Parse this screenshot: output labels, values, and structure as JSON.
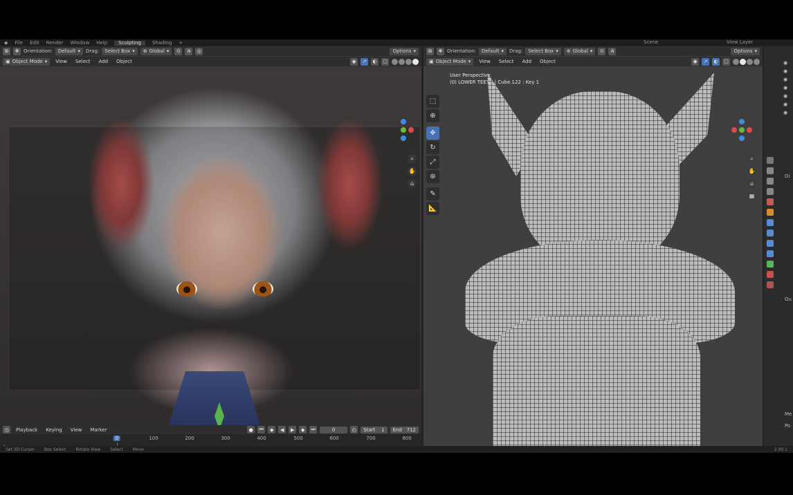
{
  "topbar": {
    "menu": [
      "File",
      "Edit",
      "Render",
      "Window",
      "Help"
    ],
    "workspace_tabs": [
      "Sculpting",
      "Shading"
    ],
    "scene_label": "Scene",
    "view_layer_label": "View Layer"
  },
  "left_editor": {
    "header": {
      "orientation_label": "Orientation:",
      "orientation_value": "Default",
      "drag_label": "Drag:",
      "drag_value": "Select Box",
      "transform_value": "Global",
      "options_label": "Options"
    },
    "subheader": {
      "mode": "Object Mode",
      "menus": [
        "View",
        "Select",
        "Add",
        "Object"
      ]
    }
  },
  "right_editor": {
    "header": {
      "orientation_label": "Orientation:",
      "orientation_value": "Default",
      "drag_label": "Drag:",
      "drag_value": "Select Box",
      "transform_value": "Global",
      "options_label": "Options"
    },
    "subheader": {
      "mode": "Object Mode",
      "menus": [
        "View",
        "Select",
        "Add",
        "Object"
      ]
    },
    "overlay": {
      "view_name": "User Perspective",
      "object_info": "(0) LOWER TEETH | Cube.122 : Key 1"
    }
  },
  "timeline": {
    "menus": [
      "Playback",
      "Keying",
      "View",
      "Marker"
    ],
    "current_frame": "0",
    "start_label": "Start",
    "start_value": "1",
    "end_label": "End",
    "end_value": "712",
    "ticks": [
      "0",
      "100",
      "200",
      "300",
      "400",
      "500",
      "600",
      "700",
      "800"
    ]
  },
  "statusbar": {
    "items": [
      "Set 3D Cursor",
      "Box Select",
      "Rotate View",
      "Select",
      "Move"
    ],
    "version": "2.90.1"
  },
  "properties": {
    "labels": [
      "Di",
      "Ou",
      "Me",
      "Po"
    ]
  },
  "colors": {
    "accent": "#4772b3",
    "x_axis": "#e24a4a",
    "y_axis": "#6bb83a",
    "z_axis": "#3f8de0"
  }
}
